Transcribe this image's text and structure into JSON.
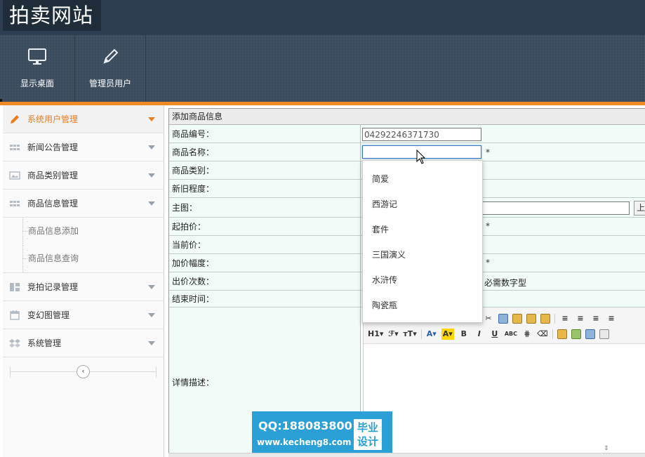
{
  "app": {
    "title": "拍卖网站"
  },
  "toolbar": {
    "buttons": [
      {
        "label": "显示桌面",
        "icon": "monitor-icon"
      },
      {
        "label": "管理员用户",
        "icon": "pencil-icon"
      }
    ]
  },
  "sidebar": {
    "items": [
      {
        "label": "系统用户管理",
        "icon": "pencil-icon",
        "active": true
      },
      {
        "label": "新闻公告管理",
        "icon": "grid-icon"
      },
      {
        "label": "商品类别管理",
        "icon": "image-icon"
      },
      {
        "label": "商品信息管理",
        "icon": "grid-icon",
        "expanded": true
      },
      {
        "label": "竞拍记录管理",
        "icon": "dashboard-icon"
      },
      {
        "label": "变幻图管理",
        "icon": "calendar-icon"
      },
      {
        "label": "系统管理",
        "icon": "dropbox-icon"
      }
    ],
    "subitems": [
      {
        "label": "商品信息添加"
      },
      {
        "label": "商品信息查询"
      }
    ],
    "collapse_symbol": "‹"
  },
  "form": {
    "title": "添加商品信息",
    "labels": {
      "product_no": "商品编号：",
      "product_name": "商品名称：",
      "category": "商品类别：",
      "condition": "新旧程度：",
      "main_image": "主图：",
      "start_price": "起拍价：",
      "current_price": "当前价：",
      "increment": "加价幅度：",
      "bid_count": "出价次数：",
      "end_time": "结束时间：",
      "details": "详情描述："
    },
    "values": {
      "product_no": "04292246371730",
      "product_name": ""
    },
    "required_mark": "*",
    "bid_count_hint": "必需数字型",
    "upload_label": "上"
  },
  "dropdown": {
    "options": [
      "简爱",
      "西游记",
      "套件",
      "三国演义",
      "水浒传",
      "陶瓷瓶"
    ]
  },
  "editor": {
    "row1": [
      "cut",
      "copy",
      "paste",
      "paste-text",
      "paste-word",
      "align-left",
      "align-center",
      "align-right",
      "justify"
    ],
    "row2": {
      "heading": "H1▾",
      "font": "ℱ▾",
      "size": "тT▾",
      "font_color": "A▾",
      "highlight": "A▾",
      "bold": "B",
      "italic": "I",
      "underline": "U",
      "strike": "ABC"
    }
  },
  "watermark": {
    "qq": "QQ:188083800",
    "url": "www.kecheng8.com",
    "badge_line1": "毕业",
    "badge_line2": "设计"
  }
}
